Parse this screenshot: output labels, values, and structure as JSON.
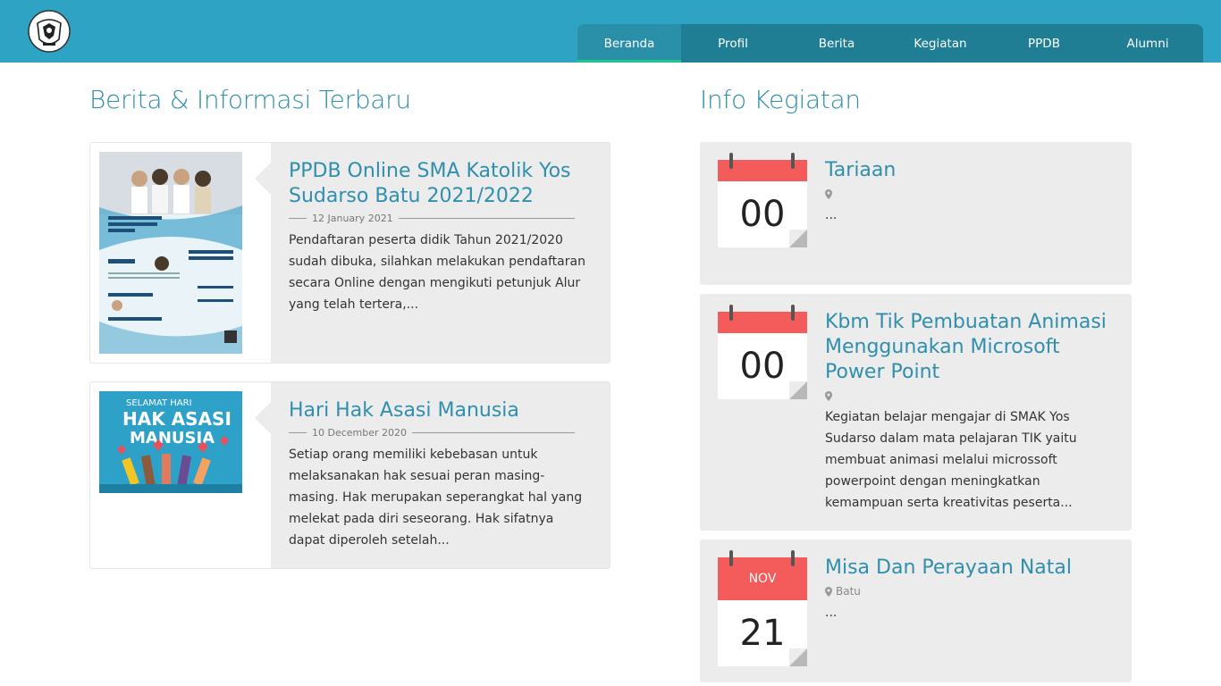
{
  "nav": {
    "items": [
      {
        "label": "Beranda",
        "active": true
      },
      {
        "label": "Profil",
        "active": false
      },
      {
        "label": "Berita",
        "active": false
      },
      {
        "label": "Kegiatan",
        "active": false
      },
      {
        "label": "PPDB",
        "active": false
      },
      {
        "label": "Alumni",
        "active": false
      }
    ]
  },
  "news": {
    "section_title": "Berita & Informasi Terbaru",
    "items": [
      {
        "title": "PPDB Online SMA Katolik Yos Sudarso Batu 2021/2022",
        "date": "12 January 2021",
        "excerpt": "Pendaftaran peserta didik Tahun 2021/2020 sudah dibuka, silahkan melakukan pendaftaran secara Online dengan mengikuti petunjuk Alur yang telah tertera,..."
      },
      {
        "title": "Hari Hak Asasi Manusia",
        "date": "10 December 2020",
        "excerpt": "Setiap orang memiliki kebebasan untuk melaksanakan hak sesuai peran masing-masing. Hak merupakan seperangkat hal yang melekat pada diri seseorang. Hak sifatnya dapat diperoleh setelah..."
      }
    ]
  },
  "events": {
    "section_title": "Info Kegiatan",
    "items": [
      {
        "month": "",
        "day": "00",
        "title": "Tariaan",
        "location": "",
        "text": "..."
      },
      {
        "month": "",
        "day": "00",
        "title": "Kbm Tik Pembuatan Animasi Menggunakan Microsoft Power Point",
        "location": "",
        "text": "Kegiatan belajar mengajar di SMAK Yos Sudarso dalam mata pelajaran TIK yaitu membuat animasi melalui microssoft powerpoint dengan meningkatkan kemampuan serta kreativitas peserta..."
      },
      {
        "month": "NOV",
        "day": "21",
        "title": "Misa Dan Perayaan Natal",
        "location": "Batu",
        "text": "..."
      }
    ]
  },
  "colors": {
    "header": "#2ea3c4",
    "nav": "#1f7e94",
    "accent": "#2f8fad",
    "calendar": "#f45b5b",
    "active_underline": "#21c48a"
  }
}
